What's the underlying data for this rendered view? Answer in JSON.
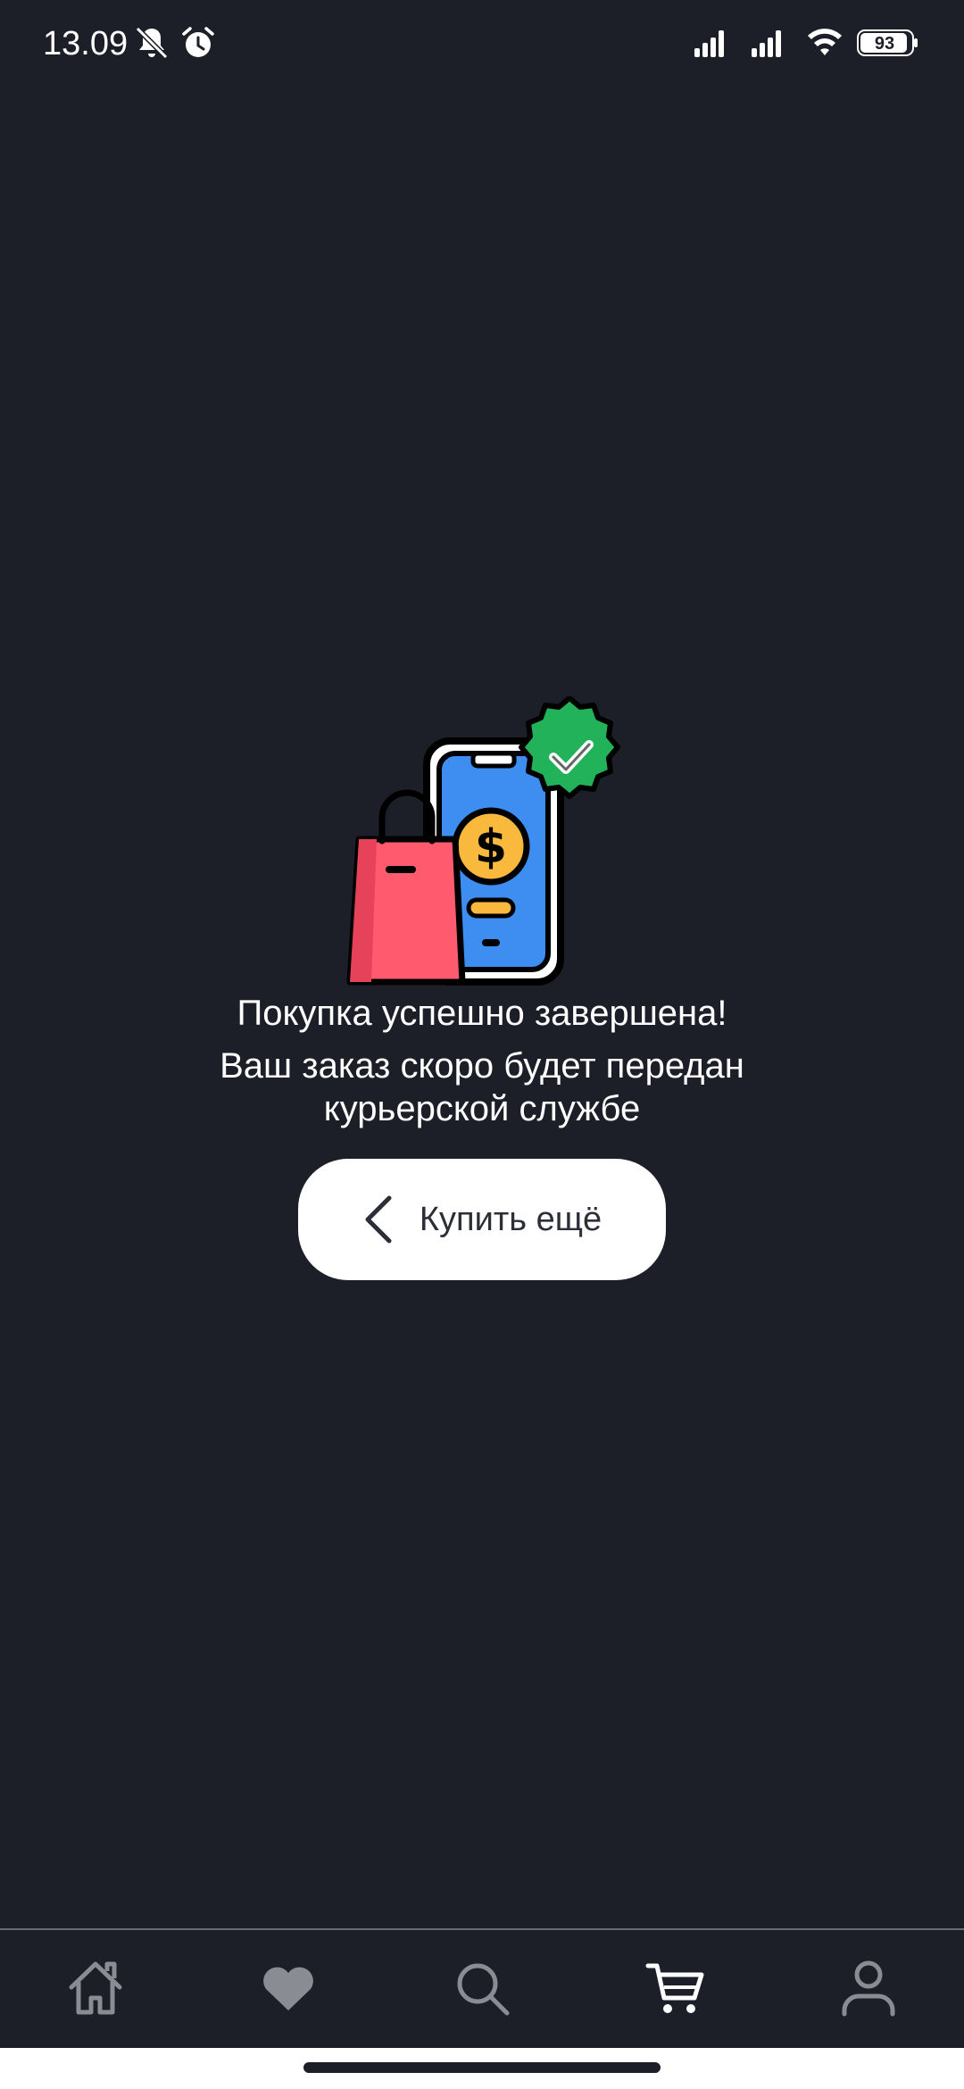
{
  "status_bar": {
    "time": "13.09",
    "battery_level": "93",
    "icons": [
      "bell-muted-icon",
      "alarm-icon",
      "signal-icon",
      "signal-icon",
      "wifi-icon",
      "battery-icon"
    ]
  },
  "illustration": {
    "icon": "purchase-success-illustration",
    "colors": {
      "phone": "#3d8ef0",
      "coin": "#f8b93c",
      "bag": "#ff5a6e",
      "badge": "#22b35a",
      "outline": "#000000"
    }
  },
  "message": {
    "title": "Покупка успешно завершена!",
    "subtitle": "Ваш заказ скоро будет передан курьерской службе"
  },
  "button": {
    "label": "Купить ещё",
    "icon": "chevron-left-icon"
  },
  "bottom_nav": {
    "items": [
      {
        "name": "home",
        "icon": "home-icon",
        "active": false
      },
      {
        "name": "favorites",
        "icon": "heart-icon",
        "active": false
      },
      {
        "name": "search",
        "icon": "search-icon",
        "active": false
      },
      {
        "name": "cart",
        "icon": "cart-icon",
        "active": true
      },
      {
        "name": "profile",
        "icon": "profile-icon",
        "active": false
      }
    ],
    "active_color": "#ffffff",
    "inactive_color": "#8a8c94"
  },
  "colors": {
    "background": "#1d1f28",
    "button_background": "#ffffff",
    "button_text": "#2c2e38"
  }
}
